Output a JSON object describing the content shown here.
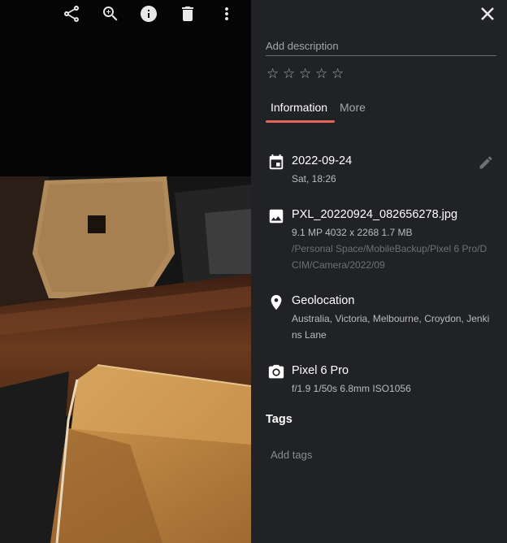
{
  "toolbar": {
    "icons": [
      "share-icon",
      "zoom-in-icon",
      "info-icon",
      "delete-icon",
      "more-vert-icon"
    ]
  },
  "panel": {
    "description_placeholder": "Add description",
    "rating": {
      "stars": [
        "☆",
        "☆",
        "☆",
        "☆",
        "☆"
      ],
      "value": 0,
      "max": 5
    },
    "tabs": [
      {
        "label": "Information",
        "active": true
      },
      {
        "label": "More",
        "active": false
      }
    ],
    "date": {
      "title": "2022-09-24",
      "subtitle": "Sat, 18:26"
    },
    "file": {
      "name": "PXL_20220924_082656278.jpg",
      "details": "9.1 MP  4032 x 2268  1.7 MB",
      "path": "/Personal Space/MobileBackup/Pixel 6 Pro/DCIM/Camera/2022/09"
    },
    "location": {
      "title": "Geolocation",
      "address": "Australia, Victoria, Melbourne, Croydon, Jenkins Lane"
    },
    "camera": {
      "model": "Pixel 6 Pro",
      "settings": "f/1.9  1/50s  6.8mm  ISO1056"
    },
    "tags": {
      "heading": "Tags",
      "placeholder": "Add tags"
    }
  },
  "colors": {
    "panel_bg": "#212226",
    "accent": "#e5675c",
    "viewer_bg": "#050505"
  }
}
